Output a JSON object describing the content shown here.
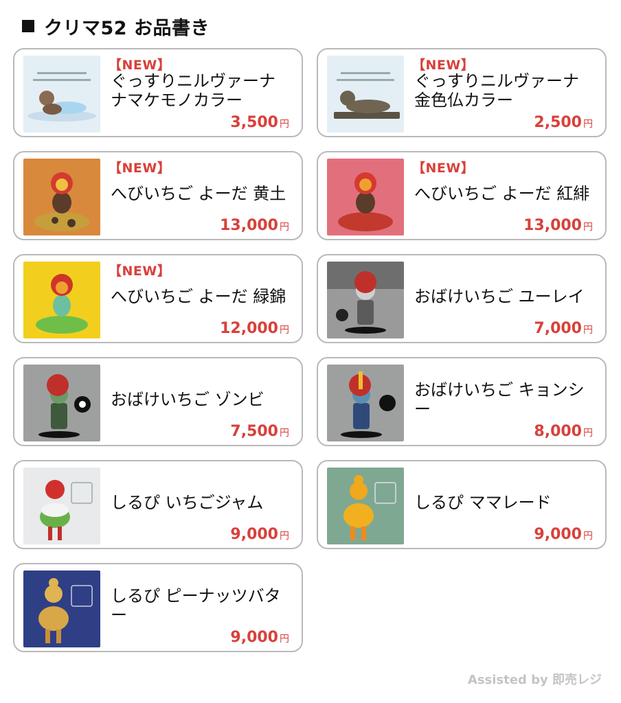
{
  "header": {
    "title": "クリマ52 お品書き"
  },
  "items": [
    {
      "badge": "【NEW】",
      "name": "ぐっすりニルヴァーナ ナマケモノカラー",
      "price": "3,500",
      "yen": "円"
    },
    {
      "badge": "【NEW】",
      "name": "ぐっすりニルヴァーナ 金色仏カラー",
      "price": "2,500",
      "yen": "円"
    },
    {
      "badge": "【NEW】",
      "name": "へびいちご よーだ 黄土",
      "price": "13,000",
      "yen": "円"
    },
    {
      "badge": "【NEW】",
      "name": "へびいちご よーだ 紅緋",
      "price": "13,000",
      "yen": "円"
    },
    {
      "badge": "【NEW】",
      "name": "へびいちご よーだ 緑錦",
      "price": "12,000",
      "yen": "円"
    },
    {
      "badge": "",
      "name": "おばけいちご ユーレイ",
      "price": "7,000",
      "yen": "円"
    },
    {
      "badge": "",
      "name": "おばけいちご ゾンビ",
      "price": "7,500",
      "yen": "円"
    },
    {
      "badge": "",
      "name": "おばけいちご キョンシー",
      "price": "8,000",
      "yen": "円"
    },
    {
      "badge": "",
      "name": "しるぴ いちごジャム",
      "price": "9,000",
      "yen": "円"
    },
    {
      "badge": "",
      "name": "しるぴ ママレード",
      "price": "9,000",
      "yen": "円"
    },
    {
      "badge": "",
      "name": "しるぴ ピーナッツバター",
      "price": "9,000",
      "yen": "円"
    }
  ],
  "footer": {
    "text": "Assisted by 即売レジ"
  }
}
